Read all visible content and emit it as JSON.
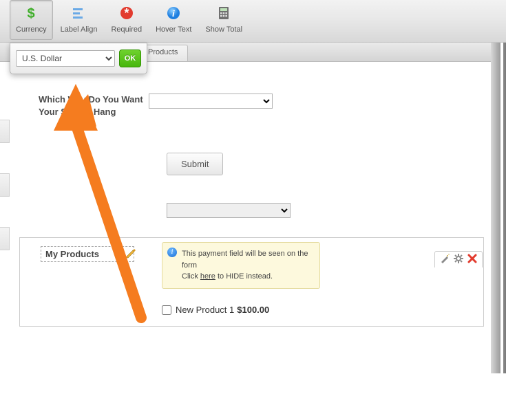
{
  "toolbar": {
    "items": [
      {
        "key": "currency",
        "label": "Currency",
        "active": true
      },
      {
        "key": "labelalign",
        "label": "Label Align",
        "active": false
      },
      {
        "key": "required",
        "label": "Required",
        "active": false
      },
      {
        "key": "hovertext",
        "label": "Hover Text",
        "active": false
      },
      {
        "key": "showtotal",
        "label": "Show Total",
        "active": false
      }
    ]
  },
  "popover": {
    "currency_value": "U.S. Dollar",
    "ok_label": "OK"
  },
  "tabs": {
    "products_label": "Products"
  },
  "form": {
    "question_label": "Which Way Do You Want Your Sign to Hang",
    "submit_label": "Submit"
  },
  "payment": {
    "section_label": "My Products",
    "tip_line1": "This payment field will be seen on the form",
    "tip_prefix": "Click ",
    "tip_link": "here",
    "tip_suffix": " to HIDE instead.",
    "product_name": "New Product 1",
    "product_price": "$100.00",
    "product_checked": false
  },
  "colors": {
    "accent_orange": "#f57c1f",
    "ok_green": "#47b60d"
  }
}
